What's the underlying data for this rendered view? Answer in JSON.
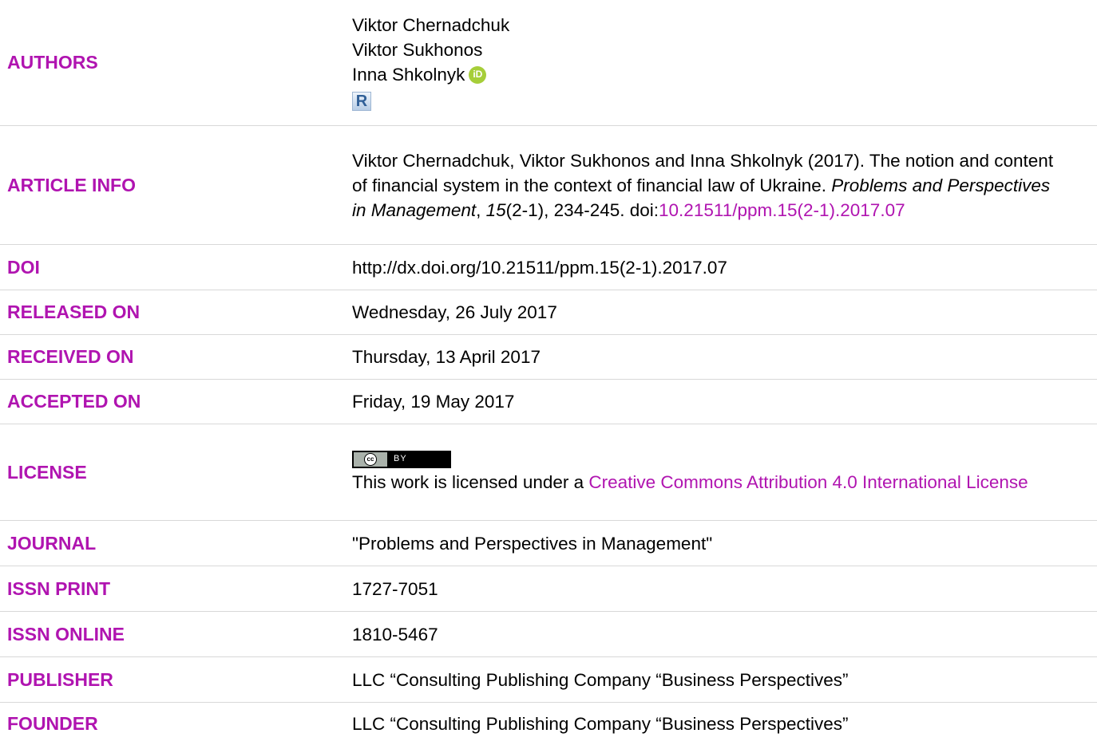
{
  "authors": {
    "label": "AUTHORS",
    "names": [
      "Viktor Chernadchuk",
      "Viktor Sukhonos",
      "Inna Shkolnyk"
    ],
    "orcid_icon_text": "iD",
    "researcherid_icon_text": "R"
  },
  "article_info": {
    "label": "ARTICLE INFO",
    "citation_prefix": "Viktor Chernadchuk, Viktor Sukhonos and Inna Shkolnyk (2017). The notion and content of financial system in the context of financial law of Ukraine. ",
    "journal_italic": "Problems and Perspectives in Management",
    "comma": ", ",
    "volume_italic": "15",
    "issue_pages": "(2-1), 234-245. doi:",
    "doi_link": "10.21511/ppm.15(2-1).2017.07"
  },
  "doi": {
    "label": "DOI",
    "value": "http://dx.doi.org/10.21511/ppm.15(2-1).2017.07"
  },
  "released": {
    "label": "RELEASED ON",
    "value": "Wednesday, 26 July 2017"
  },
  "received": {
    "label": "RECEIVED ON",
    "value": "Thursday, 13 April 2017"
  },
  "accepted": {
    "label": "ACCEPTED ON",
    "value": "Friday, 19 May 2017"
  },
  "license": {
    "label": "LICENSE",
    "badge_cc": "cc",
    "badge_by": "BY",
    "text_prefix": "This work is licensed under a ",
    "link_text": "Creative Commons Attribution 4.0 International License"
  },
  "journal": {
    "label": "JOURNAL",
    "value": "\"Problems and Perspectives in Management\""
  },
  "issn_print": {
    "label": "ISSN PRINT",
    "value": "1727-7051"
  },
  "issn_online": {
    "label": "ISSN ONLINE",
    "value": "1810-5467"
  },
  "publisher": {
    "label": "PUBLISHER",
    "value": "LLC “Consulting Publishing Company “Business Perspectives”"
  },
  "founder": {
    "label": "FOUNDER",
    "value": "LLC “Consulting Publishing Company “Business Perspectives”"
  },
  "colors": {
    "label": "#b014b0",
    "link": "#b014b0",
    "divider": "#d8d8d8",
    "orcid": "#a6ce39"
  }
}
